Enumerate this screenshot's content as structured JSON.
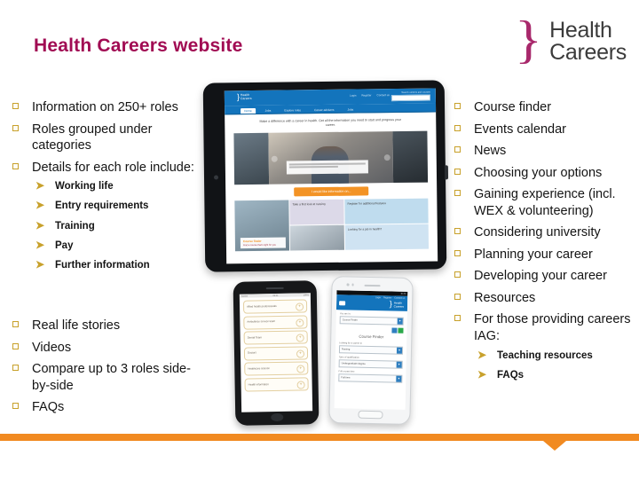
{
  "slide": {
    "title": "Health Careers website"
  },
  "logo": {
    "brace": "}",
    "line1": "Health",
    "line2": "Careers"
  },
  "left_column": {
    "items": [
      {
        "label": "Information on 250+ roles"
      },
      {
        "label": "Roles grouped under categories"
      },
      {
        "label": "Details for each role include:",
        "sub": [
          "Working life",
          "Entry requirements",
          "Training",
          "Pay",
          "Further information"
        ]
      }
    ]
  },
  "left_column_2": {
    "items": [
      {
        "label": "Real life stories"
      },
      {
        "label": "Videos"
      },
      {
        "label": "Compare up to 3 roles side-by-side"
      },
      {
        "label": "FAQs"
      }
    ]
  },
  "right_column": {
    "items": [
      {
        "label": "Course finder"
      },
      {
        "label": "Events calendar"
      },
      {
        "label": "News"
      },
      {
        "label": "Choosing your options"
      },
      {
        "label": "Gaining experience (incl. WEX & volunteering)"
      },
      {
        "label": "Considering university"
      },
      {
        "label": "Planning your career"
      },
      {
        "label": "Developing your career"
      },
      {
        "label": "Resources"
      },
      {
        "label": "For those providing careers IAG:",
        "sub": [
          "Teaching resources",
          "FAQs"
        ]
      }
    ]
  },
  "tablet": {
    "site": {
      "logo_line1": "Health",
      "logo_line2": "Careers",
      "toplinks": [
        "Login",
        "Register",
        "Contact us"
      ],
      "search_label": "Search careers and courses",
      "search_value": "",
      "nav": [
        "Home",
        "Jobs",
        "Explore roles",
        "Career advisers",
        "Jobs"
      ],
      "nav_active": "Home",
      "tagline": "Make a difference with a career in health. Get all the information you need to start and progress your career.",
      "cta": "I would like information on...",
      "tiles": [
        "Take a first look at nursing",
        "Register for additional features",
        "Course finder",
        "Find a course that's right for you",
        "Looking for a job in health?"
      ]
    }
  },
  "phone_dark": {
    "status_left": "Carrier",
    "status_center": "09:41",
    "status_right": "100%",
    "rows": [
      "Allied health professionals",
      "Ambulance service team",
      "Dental Team",
      "Doctors",
      "Healthcare science",
      "Health informatics"
    ],
    "expand_icon": "+"
  },
  "phone_white": {
    "status_time": "10:43",
    "links": [
      "Login",
      "Register",
      "Contact us"
    ],
    "brand_line1": "Health",
    "brand_line2": "Careers",
    "you_are_in_label": "You are in:",
    "you_are_in_value": "Course Finder",
    "page_title": "Course Finder",
    "fields": [
      {
        "label": "Looking for a career in",
        "value": "Nursing"
      },
      {
        "label": "Type of qualification",
        "value": "Undergraduate degree"
      },
      {
        "label": "Full or part time",
        "value": "Full time"
      }
    ],
    "chevron": "▼"
  },
  "colors": {
    "title_magenta": "#A10B53",
    "bullet_gold": "#C8A12C",
    "brand_blue": "#1374BC",
    "accent_orange": "#F18A21",
    "cta_orange": "#F39325"
  }
}
